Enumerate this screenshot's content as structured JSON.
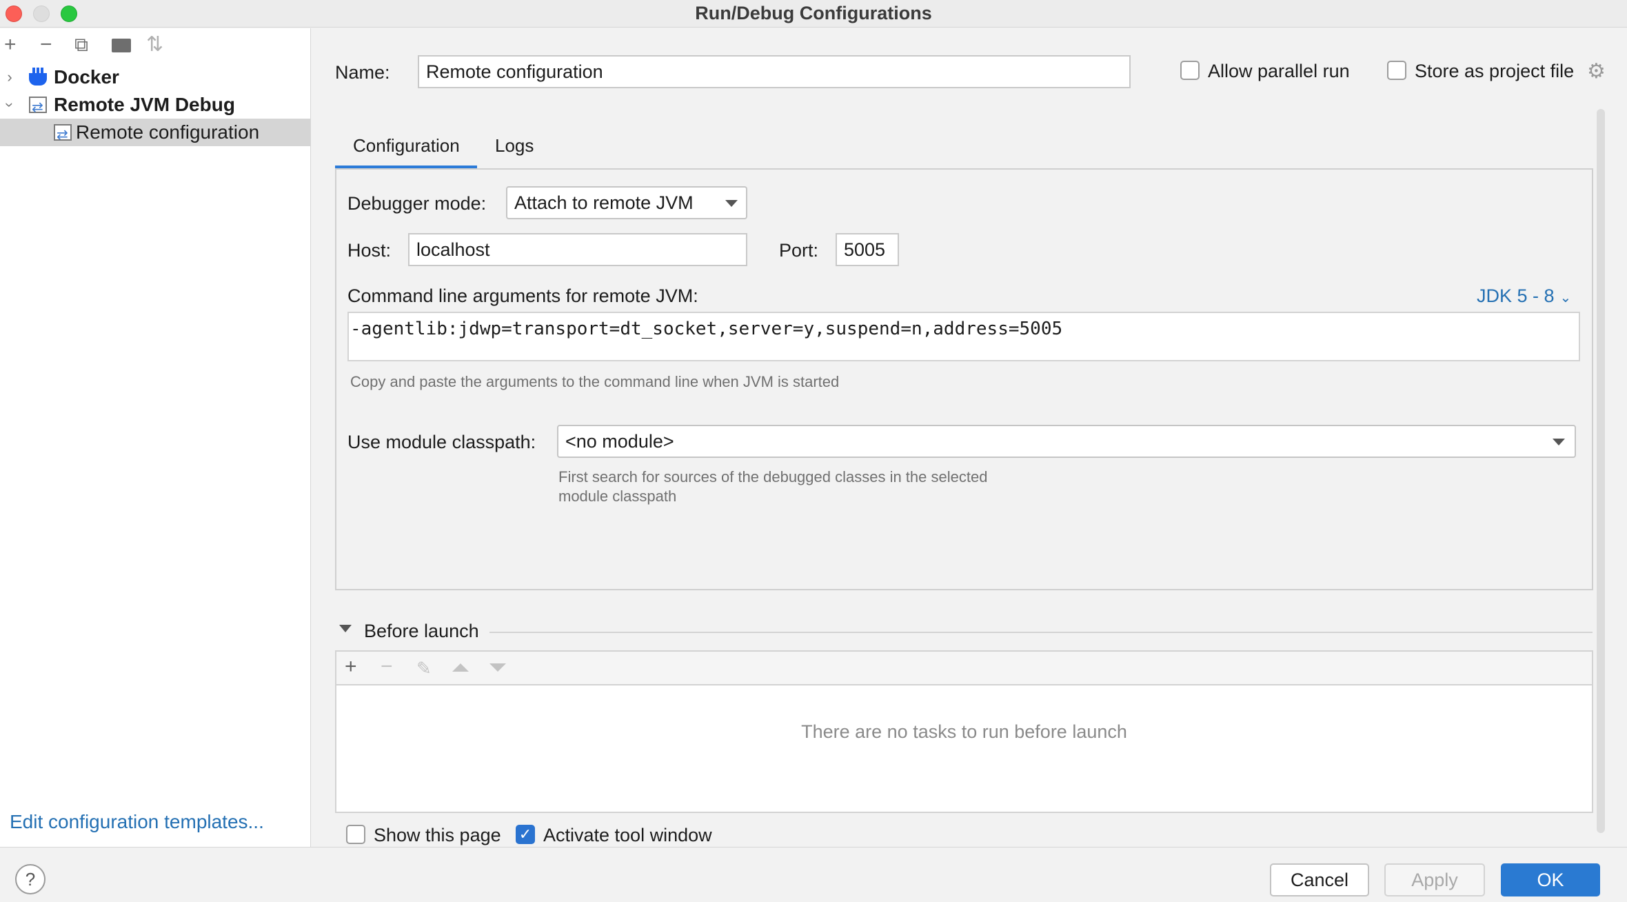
{
  "window": {
    "title": "Run/Debug Configurations"
  },
  "sidebar": {
    "toolbar": [
      {
        "name": "add-icon",
        "glyph": "+"
      },
      {
        "name": "remove-icon",
        "glyph": "−"
      },
      {
        "name": "copy-icon",
        "glyph": "⧉"
      },
      {
        "name": "folder-add-icon",
        "glyph": "▰"
      },
      {
        "name": "sort-icon",
        "glyph": "⇅"
      }
    ],
    "tree": [
      {
        "label": "Docker",
        "expanded": false,
        "icon": "docker-icon"
      },
      {
        "label": "Remote JVM Debug",
        "expanded": true,
        "icon": "remote-jvm-icon"
      },
      {
        "label": "Remote configuration",
        "selected": true,
        "icon": "remote-jvm-icon"
      }
    ],
    "edit_templates_link": "Edit configuration templates..."
  },
  "header": {
    "name_label": "Name:",
    "name_value": "Remote configuration",
    "allow_parallel_label": "Allow parallel run",
    "store_as_project_label": "Store as project file"
  },
  "tabs": [
    {
      "label": "Configuration",
      "active": true
    },
    {
      "label": "Logs",
      "active": false
    }
  ],
  "config": {
    "debugger_mode_label": "Debugger mode:",
    "debugger_mode_value": "Attach to remote JVM",
    "host_label": "Host:",
    "host_value": "localhost",
    "port_label": "Port:",
    "port_value": "5005",
    "cmd_label": "Command line arguments for remote JVM:",
    "jdk_selector": "JDK 5 - 8",
    "cmd_value": "-agentlib:jdwp=transport=dt_socket,server=y,suspend=n,address=5005",
    "cmd_hint": "Copy and paste the arguments to the command line when JVM is started",
    "module_label": "Use module classpath:",
    "module_value": "<no module>",
    "module_hint_line1": "First search for sources of the debugged classes in the selected",
    "module_hint_line2": "module classpath"
  },
  "before_launch": {
    "title": "Before launch",
    "empty_text": "There are no tasks to run before launch",
    "show_page_label": "Show this page",
    "show_page_checked": false,
    "activate_tool_label": "Activate tool window",
    "activate_tool_checked": true
  },
  "buttons": {
    "help": "?",
    "cancel": "Cancel",
    "apply": "Apply",
    "ok": "OK"
  },
  "colors": {
    "accent": "#2a7ad2",
    "link": "#2470b3",
    "selection": "#d5d5d5"
  }
}
